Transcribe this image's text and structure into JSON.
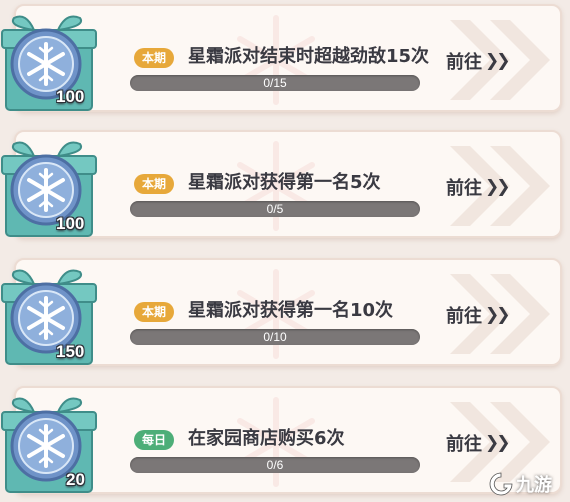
{
  "tasks": [
    {
      "badge": "本期",
      "badge_type": "period",
      "title": "星霜派对结束时超越劲敌15次",
      "progress_text": "0/15",
      "progress": 0,
      "reward": "100",
      "goto_label": "前往"
    },
    {
      "badge": "本期",
      "badge_type": "period",
      "title": "星霜派对获得第一名5次",
      "progress_text": "0/5",
      "progress": 0,
      "reward": "100",
      "goto_label": "前往"
    },
    {
      "badge": "本期",
      "badge_type": "period",
      "title": "星霜派对获得第一名10次",
      "progress_text": "0/10",
      "progress": 0,
      "reward": "150",
      "goto_label": "前往"
    },
    {
      "badge": "每日",
      "badge_type": "daily",
      "title": "在家园商店购买6次",
      "progress_text": "0/6",
      "progress": 0,
      "reward": "20",
      "goto_label": "前往"
    }
  ],
  "watermark": {
    "text": "九游"
  },
  "colors": {
    "period_badge": "#e7a83a",
    "daily_badge": "#4dae78",
    "gift_box": "#5fb8b2",
    "coin": "#6f93c8",
    "progress_track": "#7b7777"
  },
  "icons": {
    "reward": "snowflake-coin-gift-icon",
    "goto": "double-chevron-right-icon"
  }
}
